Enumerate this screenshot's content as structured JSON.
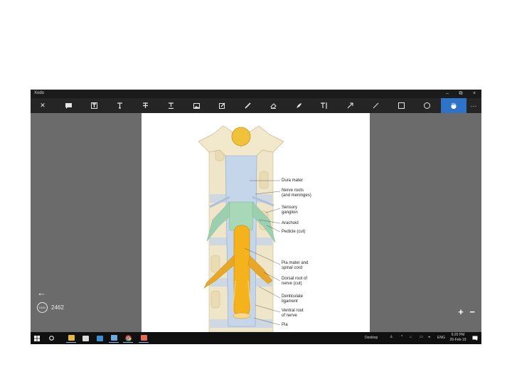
{
  "window": {
    "title": "Xodo",
    "minimize": "–",
    "restore": "⧉",
    "close": "×"
  },
  "toolbar": {
    "close": "✕",
    "items": [
      "comment-icon",
      "text-box-icon",
      "free-text-icon",
      "strikeout-icon",
      "underline-icon",
      "image-icon",
      "signature-icon",
      "pen-icon",
      "eraser-icon",
      "highlighter-icon",
      "text-select-icon",
      "arrow-icon",
      "line-icon",
      "rectangle-icon",
      "ellipse-icon",
      "pan-hand-icon",
      "more-icon"
    ],
    "more": "···"
  },
  "document": {
    "labels": [
      "Dura mater",
      "Nerve roots\n(and meninges)",
      "Sensory\nganglion",
      "Arachoid",
      "Pedicle (cut)",
      "Pia mater and\nspinal cord",
      "Dorsal root of\nnerve (cut)",
      "Denticulate\nligament",
      "Ventral root\nof nerve",
      "Pia"
    ]
  },
  "viewer": {
    "back": "←",
    "badge": "HOD",
    "page_count": "2462",
    "zoom_in": "+",
    "zoom_out": "−"
  },
  "taskbar": {
    "desktop_label": "Desktop",
    "lang": "ENG",
    "time": "6:20 PM",
    "date": "26-Feb-19",
    "colors": {
      "accent": "#2f73c8",
      "taskbar": "#101010",
      "toolbar": "#252525"
    }
  }
}
